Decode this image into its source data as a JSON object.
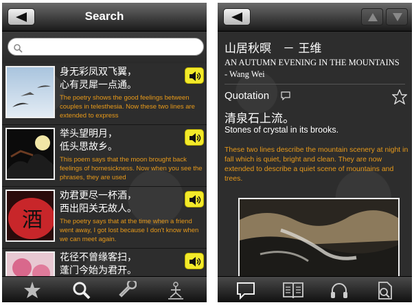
{
  "left_screen": {
    "title": "Search",
    "search": {
      "value": "",
      "placeholder": ""
    },
    "results": [
      {
        "poem": "身无彩凤双飞翼，\n心有灵犀一点通。",
        "description": "The poetry shows the good feelings between couples in telesthesia. Now these two lines are extended to express",
        "thumbnail": "birds-in-sky-photo"
      },
      {
        "poem": "举头望明月，\n低头思故乡。",
        "description": "This poem says that the moon brought back feelings of homesickness. Now when you see the phrases, they are used",
        "thumbnail": "moon-night-photo"
      },
      {
        "poem": "劝君更尽一杯酒，\n西出阳关无故人。",
        "description": "The poetry says that at the time when a friend went away, I got lost because I don't know when we can meet again.",
        "thumbnail": "wine-lantern-photo"
      },
      {
        "poem": "花径不曾缘客扫，\n蓬门今始为君开。",
        "description": "",
        "thumbnail": "pink-flowers-photo"
      }
    ],
    "tabs": [
      "favorites-icon",
      "search-icon",
      "settings-icon",
      "meditation-icon"
    ]
  },
  "right_screen": {
    "poem_title_cn": "山居秋暝　－ 王维",
    "poem_title_en": "AN AUTUMN EVENING IN THE MOUNTAINS - Wang Wei",
    "section_label": "Quotation",
    "quote_cn": "清泉石上流。",
    "quote_en": "Stones of crystal in its brooks.",
    "quote_description": "These two lines describe the mountain scenery at night in fall which is quiet, bright and clean. They are now extended to describe a quiet scene of mountains and trees.",
    "image": "stream-over-rocks-photo",
    "tabs": [
      "quotation-icon",
      "book-icon",
      "headphones-icon",
      "document-search-icon"
    ]
  },
  "colors": {
    "accent_orange": "#e89a1a",
    "audio_yellow": "#f3ea2a",
    "background": "#2d2d2d"
  }
}
